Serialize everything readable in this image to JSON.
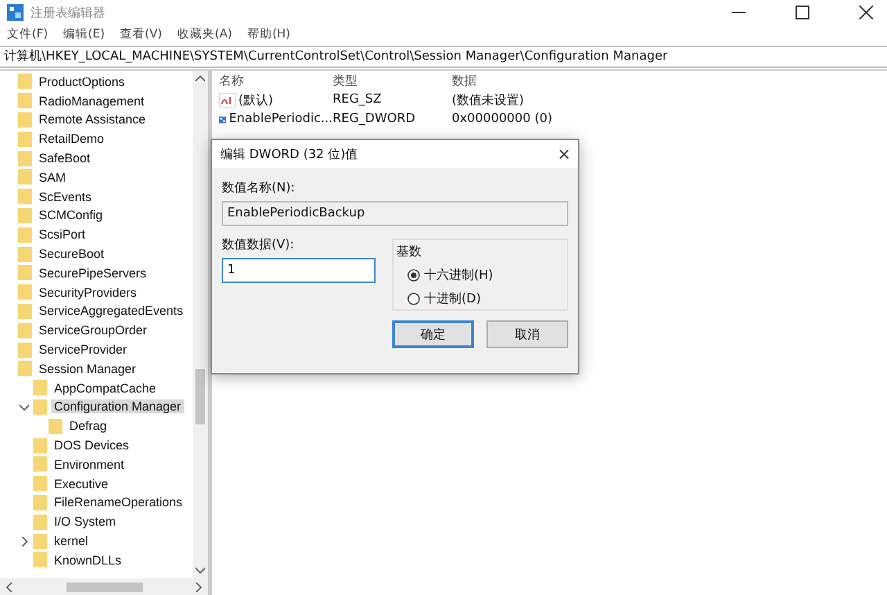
{
  "window": {
    "title": "注册表编辑器"
  },
  "menu": [
    "文件(F)",
    "编辑(E)",
    "查看(V)",
    "收藏夹(A)",
    "帮助(H)"
  ],
  "address": "计算机\\HKEY_LOCAL_MACHINE\\SYSTEM\\CurrentControlSet\\Control\\Session Manager\\Configuration Manager",
  "tree": [
    {
      "label": "ProductOptions",
      "selected": false
    },
    {
      "label": "RadioManagement",
      "selected": false
    },
    {
      "label": "Remote Assistance",
      "selected": false
    },
    {
      "label": "RetailDemo",
      "selected": false
    },
    {
      "label": "SafeBoot",
      "selected": false
    },
    {
      "label": "SAM",
      "selected": false
    },
    {
      "label": "ScEvents",
      "selected": false
    },
    {
      "label": "SCMConfig",
      "selected": false
    },
    {
      "label": "ScsiPort",
      "selected": false
    },
    {
      "label": "SecureBoot",
      "selected": false
    },
    {
      "label": "SecurePipeServers",
      "selected": false
    },
    {
      "label": "SecurityProviders",
      "selected": false
    },
    {
      "label": "ServiceAggregatedEvents",
      "selected": false
    },
    {
      "label": "ServiceGroupOrder",
      "selected": false
    },
    {
      "label": "ServiceProvider",
      "selected": false
    },
    {
      "label": "Session Manager",
      "selected": false,
      "children": [
        {
          "label": "AppCompatCache",
          "selected": false
        },
        {
          "label": "Configuration Manager",
          "selected": true,
          "expanded": true,
          "children": [
            {
              "label": "Defrag",
              "selected": false
            }
          ]
        },
        {
          "label": "DOS Devices",
          "selected": false
        },
        {
          "label": "Environment",
          "selected": false
        },
        {
          "label": "Executive",
          "selected": false
        },
        {
          "label": "FileRenameOperations",
          "selected": false
        },
        {
          "label": "I/O System",
          "selected": false
        },
        {
          "label": "kernel",
          "selected": false,
          "expanded": false
        },
        {
          "label": "KnownDLLs",
          "selected": false
        }
      ]
    }
  ],
  "table": {
    "columns": [
      "名称",
      "类型",
      "数据"
    ],
    "rows": [
      {
        "kind": "string",
        "name": "(默认)",
        "type": "REG_SZ",
        "data": "(数值未设置)"
      },
      {
        "kind": "binary",
        "name": "EnablePeriodic...",
        "type": "REG_DWORD",
        "data": "0x00000000 (0)"
      }
    ]
  },
  "dialog": {
    "title": "编辑 DWORD (32 位)值",
    "close": "×",
    "name_label": "数值名称(N):",
    "name_value": "EnablePeriodicBackup",
    "data_label": "数值数据(V):",
    "data_value": "1",
    "base_label": "基数",
    "bases": [
      {
        "label": "十六进制(H)",
        "selected": true
      },
      {
        "label": "十进制(D)",
        "selected": false
      }
    ],
    "buttons": [
      {
        "label": "确定",
        "default": true
      },
      {
        "label": "取消",
        "default": false
      }
    ]
  }
}
